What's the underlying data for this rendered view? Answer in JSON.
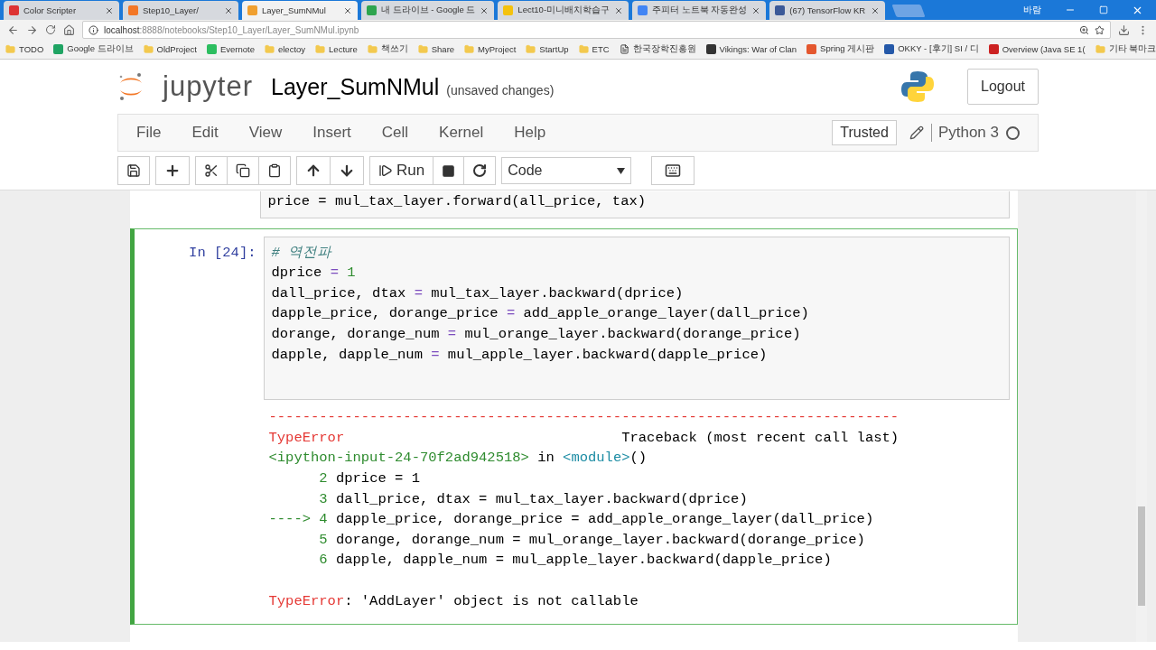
{
  "browser": {
    "tabs": [
      {
        "title": "Color Scripter",
        "selected": false
      },
      {
        "title": "Step10_Layer/",
        "selected": false
      },
      {
        "title": "Layer_SumNMul",
        "selected": true
      },
      {
        "title": "내 드라이브 - Google 드",
        "selected": false
      },
      {
        "title": "Lect10-미니배치학습구",
        "selected": false
      },
      {
        "title": "주피터 노트북 자동완성",
        "selected": false
      },
      {
        "title": "(67) TensorFlow KR",
        "selected": false
      }
    ],
    "user": "바람",
    "url_host": "localhost",
    "url_rest": ":8888/notebooks/Step10_Layer/Layer_SumNMul.ipynb",
    "bookmarks": [
      "TODO",
      "Google 드라이브",
      "OldProject",
      "Evernote",
      "electoy",
      "Lecture",
      "책쓰기",
      "Share",
      "MyProject",
      "StartUp",
      "ETC",
      "한국장학진흥원",
      "Vikings: War of Clan",
      "Spring 게시판",
      "OKKY - [후기] SI / 디",
      "Overview (Java SE 1("
    ],
    "other_bookmarks": "기타 북마크"
  },
  "notebook": {
    "logo_text": "jupyter",
    "title": "Layer_SumNMul",
    "status": "(unsaved changes)",
    "logout": "Logout",
    "menu": [
      "File",
      "Edit",
      "View",
      "Insert",
      "Cell",
      "Kernel",
      "Help"
    ],
    "trusted": "Trusted",
    "kernel": "Python 3",
    "kernel_busy": false,
    "run_label": "Run",
    "cell_type": "Code"
  },
  "cells": [
    {
      "selected": false,
      "lines": [
        [
          {
            "t": "price = mul_tax_layer.forward(all_price, tax)",
            "kind": "plain"
          }
        ]
      ]
    },
    {
      "prompt": "In [24]:",
      "selected": true,
      "lines": [
        [
          {
            "t": "# 역전파",
            "kind": "comment"
          }
        ],
        [
          {
            "t": "dprice ",
            "kind": "plain"
          },
          {
            "t": "=",
            "kind": "op"
          },
          {
            "t": " 1",
            "kind": "number"
          }
        ],
        [
          {
            "t": "dall_price, dtax ",
            "kind": "plain"
          },
          {
            "t": "=",
            "kind": "op"
          },
          {
            "t": " mul_tax_layer.backward(dprice)",
            "kind": "plain"
          }
        ],
        [
          {
            "t": "dapple_price, dorange_price ",
            "kind": "plain"
          },
          {
            "t": "=",
            "kind": "op"
          },
          {
            "t": " add_apple_orange_layer(dall_price)",
            "kind": "plain"
          }
        ],
        [
          {
            "t": "dorange, dorange_num ",
            "kind": "plain"
          },
          {
            "t": "=",
            "kind": "op"
          },
          {
            "t": " mul_orange_layer.backward(dorange_price)",
            "kind": "plain"
          }
        ],
        [
          {
            "t": "dapple, dapple_num ",
            "kind": "plain"
          },
          {
            "t": "=",
            "kind": "op"
          },
          {
            "t": " mul_apple_layer.backward(dapple_price)",
            "kind": "plain"
          }
        ]
      ],
      "output": [
        [
          {
            "t": "---------------------------------------------------------------------------",
            "kind": "error"
          }
        ],
        [
          {
            "t": "TypeError                                 ",
            "kind": "error"
          },
          {
            "t": "Traceback (most recent call last)",
            "kind": "plain"
          }
        ],
        [
          {
            "t": "<ipython-input-24-70f2ad942518>",
            "kind": "green"
          },
          {
            "t": " in ",
            "kind": "plain"
          },
          {
            "t": "<module>",
            "kind": "cyan"
          },
          {
            "t": "()",
            "kind": "plain"
          }
        ],
        [
          {
            "t": "      2 ",
            "kind": "green"
          },
          {
            "t": "dprice = 1",
            "kind": "plain"
          }
        ],
        [
          {
            "t": "      3 ",
            "kind": "green"
          },
          {
            "t": "dall_price, dtax = mul_tax_layer.backward(dprice)",
            "kind": "plain"
          }
        ],
        [
          {
            "t": "----> 4 ",
            "kind": "green"
          },
          {
            "t": "dapple_price, dorange_price = add_apple_orange_layer(dall_price)",
            "kind": "plain"
          }
        ],
        [
          {
            "t": "      5 ",
            "kind": "green"
          },
          {
            "t": "dorange, dorange_num = mul_orange_layer.backward(dorange_price)",
            "kind": "plain"
          }
        ],
        [
          {
            "t": "      6 ",
            "kind": "green"
          },
          {
            "t": "dapple, dapple_num = mul_apple_layer.backward(dapple_price)",
            "kind": "plain"
          }
        ]
      ],
      "error_message": [
        {
          "t": "TypeError",
          "kind": "error"
        },
        {
          "t": ": 'AddLayer' object is not callable",
          "kind": "plain"
        }
      ]
    }
  ]
}
